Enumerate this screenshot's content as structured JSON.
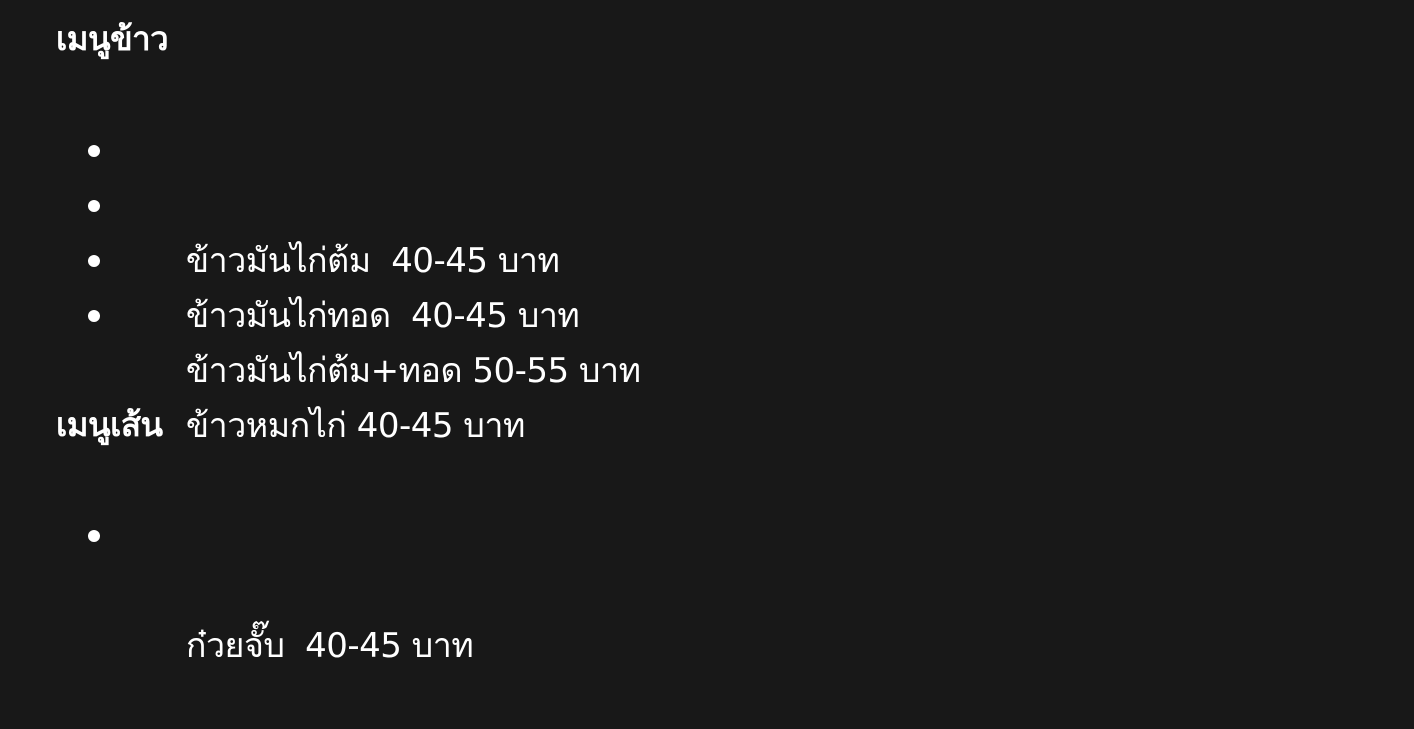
{
  "sections": [
    {
      "heading": "เมนูข้าว",
      "items": [
        "ข้าวมันไก่ต้ม  40-45 บาท",
        "ข้าวมันไก่ทอด  40-45 บาท",
        "ข้าวมันไก่ต้ม+ทอด 50-55 บาท",
        "ข้าวหมกไก่ 40-45 บาท"
      ]
    },
    {
      "heading": "เมนูเส้น",
      "items": [
        "ก๋วยจั๊บ  40-45 บาท"
      ]
    }
  ]
}
